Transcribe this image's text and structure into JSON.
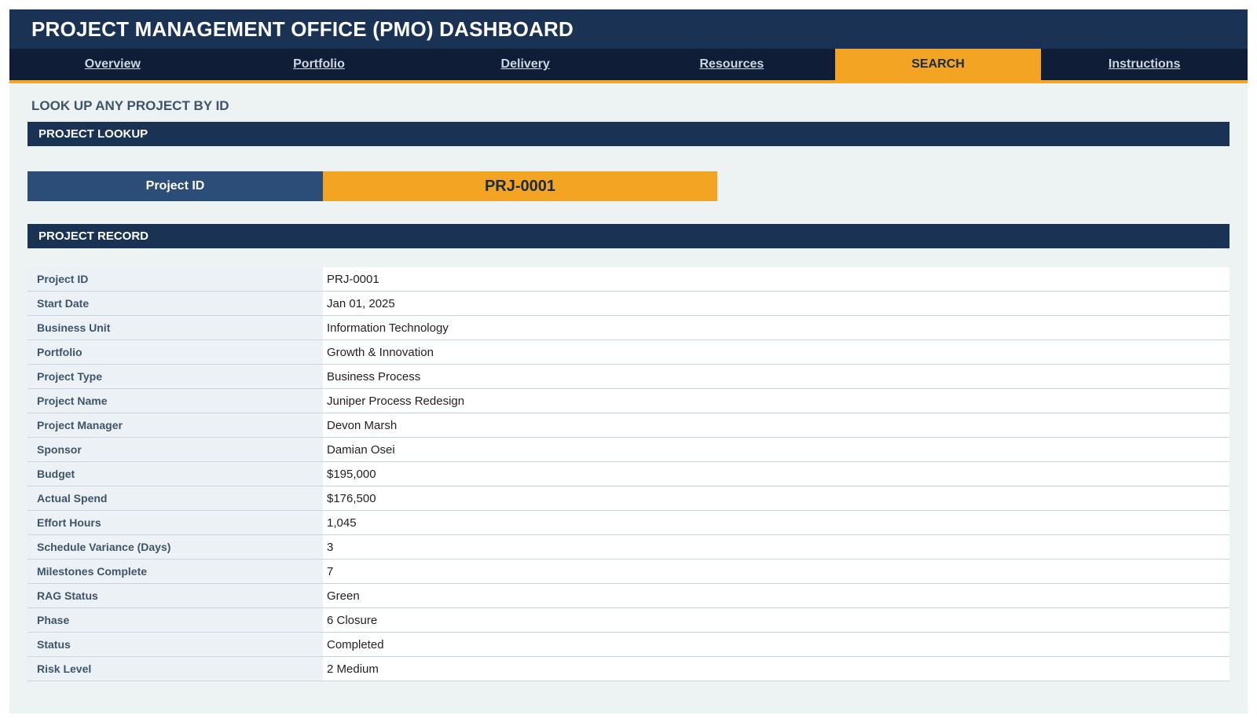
{
  "header": {
    "title": "PROJECT MANAGEMENT OFFICE (PMO) DASHBOARD"
  },
  "nav": {
    "tabs": [
      {
        "label": "Overview"
      },
      {
        "label": "Portfolio"
      },
      {
        "label": "Delivery"
      },
      {
        "label": "Resources"
      },
      {
        "label": "SEARCH"
      },
      {
        "label": "Instructions"
      }
    ],
    "active": "SEARCH"
  },
  "page": {
    "subtitle": "LOOK UP ANY PROJECT BY ID"
  },
  "lookup": {
    "header": "PROJECT LOOKUP",
    "label": "Project ID",
    "value": "PRJ-0001"
  },
  "record": {
    "header": "PROJECT RECORD",
    "rows": [
      {
        "label": "Project ID",
        "value": "PRJ-0001"
      },
      {
        "label": "Start Date",
        "value": "Jan 01, 2025"
      },
      {
        "label": "Business Unit",
        "value": "Information Technology"
      },
      {
        "label": "Portfolio",
        "value": "Growth & Innovation"
      },
      {
        "label": "Project Type",
        "value": "Business Process"
      },
      {
        "label": "Project Name",
        "value": "Juniper Process Redesign"
      },
      {
        "label": "Project Manager",
        "value": "Devon Marsh"
      },
      {
        "label": "Sponsor",
        "value": "Damian Osei"
      },
      {
        "label": "Budget",
        "value": "$195,000"
      },
      {
        "label": "Actual Spend",
        "value": "$176,500"
      },
      {
        "label": "Effort Hours",
        "value": "1,045"
      },
      {
        "label": "Schedule Variance (Days)",
        "value": "3"
      },
      {
        "label": "Milestones Complete",
        "value": "7"
      },
      {
        "label": "RAG Status",
        "value": "Green"
      },
      {
        "label": "Phase",
        "value": "6 Closure"
      },
      {
        "label": "Status",
        "value": "Completed"
      },
      {
        "label": "Risk Level",
        "value": "2 Medium"
      }
    ]
  },
  "colors": {
    "navy": "#1a3355",
    "nav_dark": "#0f1e36",
    "accent_orange": "#f4a423",
    "label_blue": "#2b4d78",
    "background": "#edf2f2"
  }
}
